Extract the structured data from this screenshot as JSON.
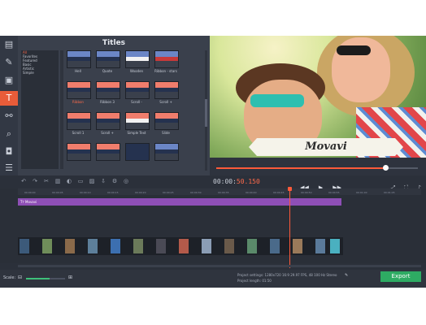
{
  "titles_panel": {
    "heading": "Titles",
    "categories": [
      "All",
      "Favorites",
      "Featured",
      "Basic",
      "Artistic",
      "Simple"
    ]
  },
  "thumb_labels": [
    "Hell",
    "Quote",
    "Wooden",
    "Ribbon - stars",
    "Ribbon",
    "Ribbon 3",
    "Scroll -",
    "Scroll +",
    "Scroll 1",
    "Scroll +",
    "Simple Text",
    "Slide"
  ],
  "tool_icons": [
    "import-icon",
    "magic-wand-icon",
    "filters-icon",
    "titles-icon",
    "transitions-icon",
    "zoom-icon",
    "stickers-icon",
    "menu-icon"
  ],
  "preview": {
    "banner_text": "Movavi",
    "seek_progress": 0.84
  },
  "playback": {
    "timecode_main": "00:00:",
    "timecode_highlight": "50.150",
    "prev_icon": "skip-back-icon",
    "play_icon": "play-icon",
    "next_icon": "skip-forward-icon"
  },
  "ruler_ticks": [
    "00:00:00",
    "00:00:05",
    "00:00:10",
    "00:00:15",
    "00:00:20",
    "00:00:25",
    "00:00:30",
    "00:00:35",
    "00:00:40",
    "00:00:45",
    "00:00:50",
    "00:00:55",
    "00:01:00",
    "00:01:05"
  ],
  "timeline": {
    "title_clip_label": "Tт Movavi"
  },
  "bottom_bar": {
    "scale_label": "Scale:",
    "zoom_level": 0.6,
    "project_settings": "Project settings: 1280x720 16:9 29.97 FPS, 48 100 Hz Stereo",
    "project_length": "Project length: 01:50",
    "export_label": "Export"
  },
  "colors": {
    "accent": "#e85c39",
    "title_clip": "#8e4fb6",
    "export": "#2eab63",
    "playhead": "#ff5a3a"
  }
}
